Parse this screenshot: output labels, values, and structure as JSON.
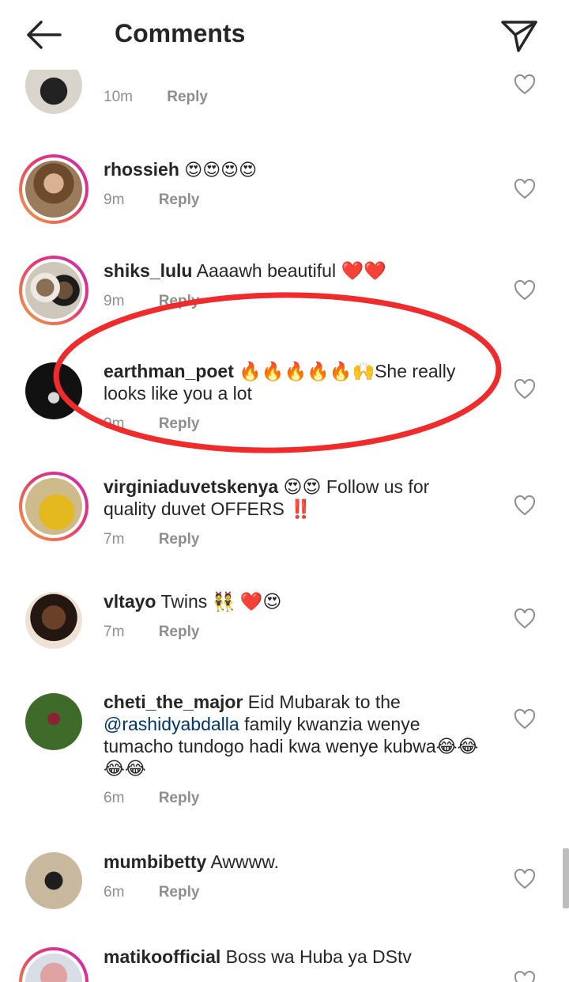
{
  "header": {
    "title": "Comments",
    "back_icon": "arrow-left-icon",
    "send_icon": "paper-plane-icon"
  },
  "reply_label": "Reply",
  "comments": [
    {
      "username": "",
      "text": "",
      "time": "10m"
    },
    {
      "username": "rhossieh",
      "text": "😍😍😍😍",
      "time": "9m"
    },
    {
      "username": "shiks_lulu",
      "text": "Aaaawh beautiful ❤️❤️",
      "time": "9m"
    },
    {
      "username": "earthman_poet",
      "text": "🔥🔥🔥🔥🔥🙌She really looks like you a lot",
      "time": "9m"
    },
    {
      "username": "virginiaduvetskenya",
      "text": "😍😍 Follow us for quality duvet OFFERS ‼️",
      "time": "7m"
    },
    {
      "username": "vltayo",
      "text": "Twins 👯 ❤️😍",
      "time": "7m"
    },
    {
      "username": "cheti_the_major",
      "text_before": "Eid Mubarak to the",
      "mention": "@rashidyabdalla",
      "text_after": "family kwanzia wenye tumacho tundogo hadi kwa wenye kubwa😂😂😂😂",
      "time": "6m"
    },
    {
      "username": "mumbibetty",
      "text": "Awwww.",
      "time": "6m"
    },
    {
      "username": "matikoofficial",
      "text": "Boss wa Huba ya DStv",
      "time": ""
    }
  ],
  "colors": {
    "annotation": "#ef2b2b",
    "mention": "#00376b",
    "meta": "#8e8e8e"
  },
  "icons": {
    "like": "heart-outline-icon"
  }
}
